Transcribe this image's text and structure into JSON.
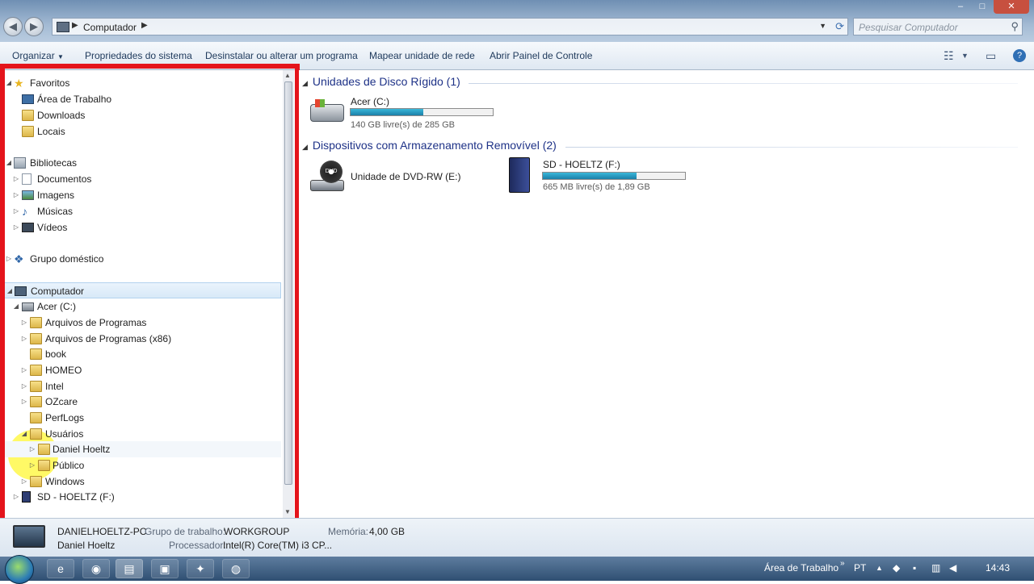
{
  "window": {
    "address_crumb": "Computador",
    "search_placeholder": "Pesquisar Computador",
    "controls": {
      "minimize": "–",
      "maximize": "□",
      "close": "✕"
    }
  },
  "toolbar": {
    "organize": "Organizar",
    "items": [
      "Propriedades do sistema",
      "Desinstalar ou alterar um programa",
      "Mapear unidade de rede",
      "Abrir Painel de Controle"
    ]
  },
  "nav": {
    "favorites": {
      "label": "Favoritos",
      "items": [
        "Área de Trabalho",
        "Downloads",
        "Locais"
      ]
    },
    "libraries": {
      "label": "Bibliotecas",
      "items": [
        "Documentos",
        "Imagens",
        "Músicas",
        "Vídeos"
      ]
    },
    "homegroup": "Grupo doméstico",
    "computer": "Computador",
    "drive_c": "Acer (C:)",
    "folders": [
      "Arquivos de Programas",
      "Arquivos de Programas (x86)",
      "book",
      "HOMEO",
      "Intel",
      "OZcare",
      "PerfLogs",
      "Usuários"
    ],
    "users": [
      "Daniel Hoeltz",
      "Público"
    ],
    "windows": "Windows",
    "drive_f": "SD - HOELTZ (F:)"
  },
  "content": {
    "hard_disks": {
      "title": "Unidades de Disco Rígido (1)",
      "drive": {
        "name": "Acer (C:)",
        "free": "140 GB livre(s) de 285 GB",
        "used_fraction": 0.51
      }
    },
    "removable": {
      "title": "Dispositivos com Armazenamento Removível (2)",
      "dvd": {
        "name": "Unidade de DVD-RW (E:)",
        "icon_text": "DVD"
      },
      "sd": {
        "name": "SD - HOELTZ (F:)",
        "free": "665 MB livre(s) de 1,89 GB",
        "used_fraction": 0.66
      }
    }
  },
  "status": {
    "computer_name": "DANIELHOELTZ-PC",
    "user": "Daniel Hoeltz",
    "workgroup_label": "Grupo de trabalho:",
    "workgroup": "WORKGROUP",
    "memory_label": "Memória:",
    "memory": "4,00 GB",
    "processor_label": "Processador:",
    "processor": "Intel(R) Core(TM) i3 CP..."
  },
  "taskbar": {
    "desktop_label": "Área de Trabalho",
    "lang": "PT",
    "time": "14:43"
  }
}
